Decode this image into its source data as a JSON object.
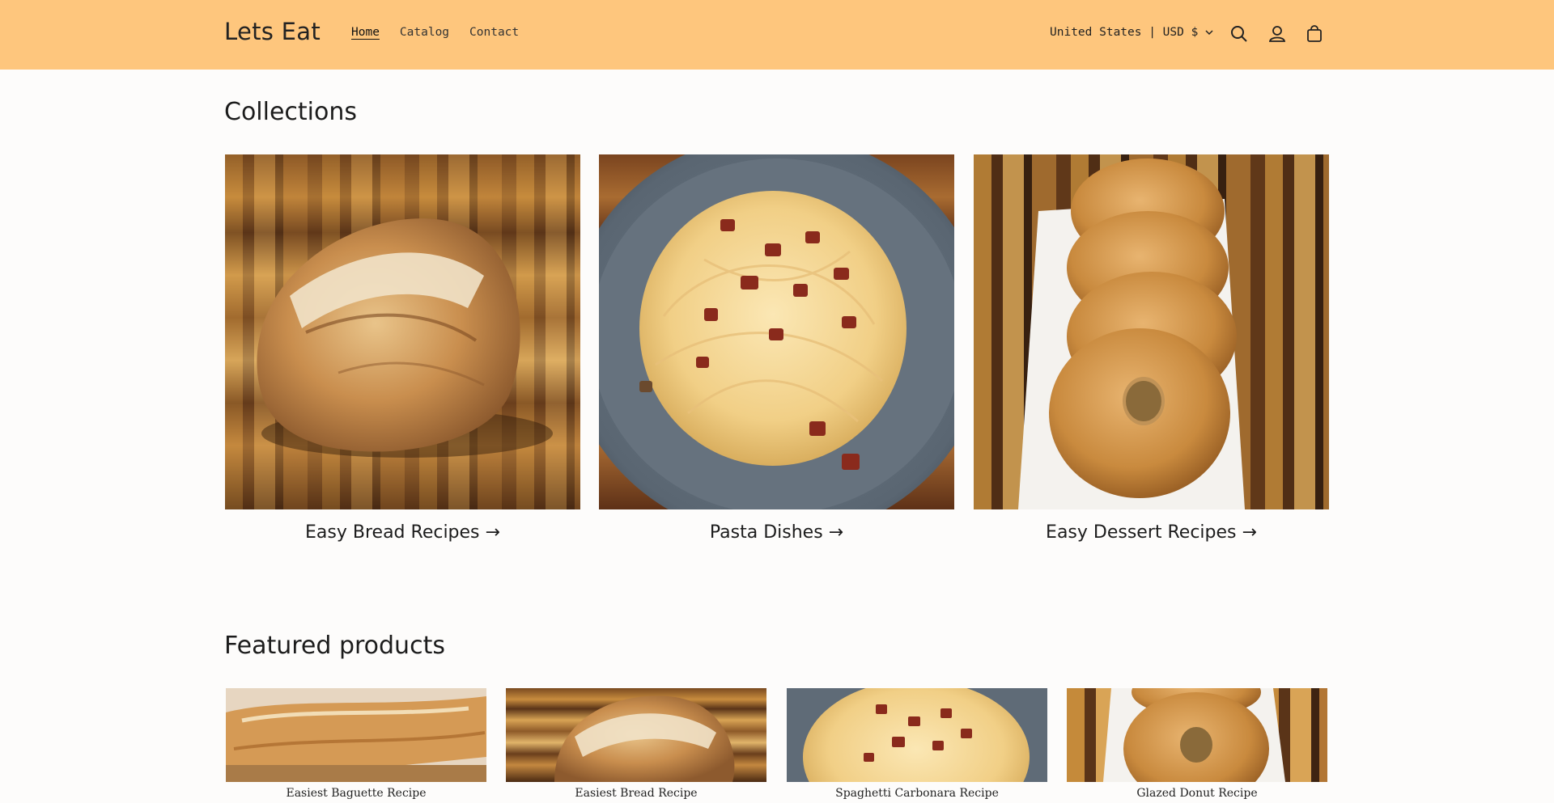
{
  "header": {
    "logo": "Lets Eat",
    "nav": [
      {
        "label": "Home",
        "active": true
      },
      {
        "label": "Catalog",
        "active": false
      },
      {
        "label": "Contact",
        "active": false
      }
    ],
    "currency": "United States | USD $",
    "icons": [
      "chevron-down-icon",
      "search-icon",
      "account-icon",
      "cart-icon"
    ],
    "background": "#fec67d"
  },
  "collections": {
    "title": "Collections",
    "items": [
      {
        "label": "Easy Bread Recipes →",
        "image": "bread-loaf-photo"
      },
      {
        "label": "Pasta Dishes →",
        "image": "spaghetti-carbonara-photo"
      },
      {
        "label": "Easy Dessert Recipes →",
        "image": "glazed-donuts-photo"
      }
    ]
  },
  "featured": {
    "title": "Featured products",
    "items": [
      {
        "title": "Easiest Baguette Recipe",
        "image": "baguette-photo"
      },
      {
        "title": "Easiest Bread Recipe",
        "image": "bread-loaf-photo"
      },
      {
        "title": "Spaghetti Carbonara Recipe",
        "image": "spaghetti-carbonara-photo"
      },
      {
        "title": "Glazed Donut Recipe",
        "image": "glazed-donuts-photo"
      }
    ]
  }
}
